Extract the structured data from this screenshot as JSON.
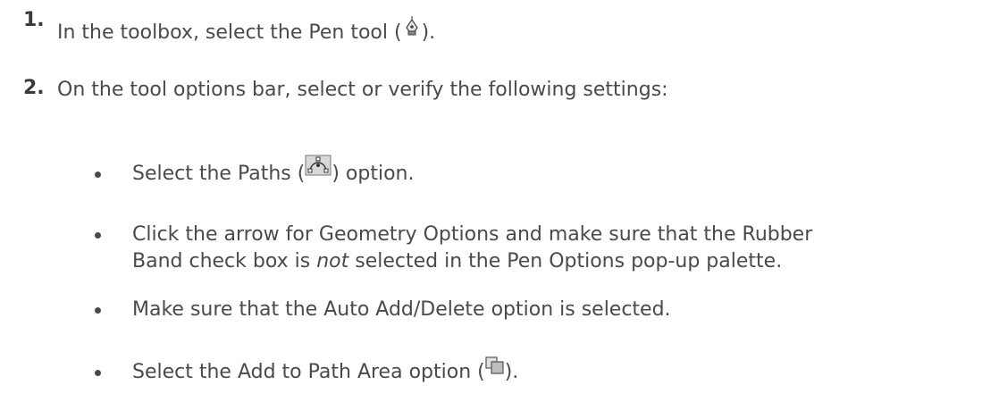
{
  "steps": [
    {
      "number": "1.",
      "text_before_icon": "In the toolbox, select the Pen tool (",
      "icon": "pen-tool-icon",
      "text_after_icon": ")."
    },
    {
      "number": "2.",
      "text": "On the tool options bar, select or verify the following settings:"
    }
  ],
  "bullets": [
    {
      "text_before_icon": "Select the Paths (",
      "icon": "paths-option-icon",
      "text_after_icon": ") option."
    },
    {
      "line1": "Click the arrow for Geometry Options and make sure that the Rubber",
      "line2_before_em": "Band check box is ",
      "line2_em": "not",
      "line2_after_em": " selected in the Pen Options pop-up palette."
    },
    {
      "text": "Make sure that the Auto Add/Delete option is selected."
    },
    {
      "text_before_icon": "Select the Add to Path Area option (",
      "icon": "add-to-path-area-icon",
      "text_after_icon": ")."
    }
  ],
  "colors": {
    "text": "#4a4a4a",
    "background": "#ffffff"
  }
}
